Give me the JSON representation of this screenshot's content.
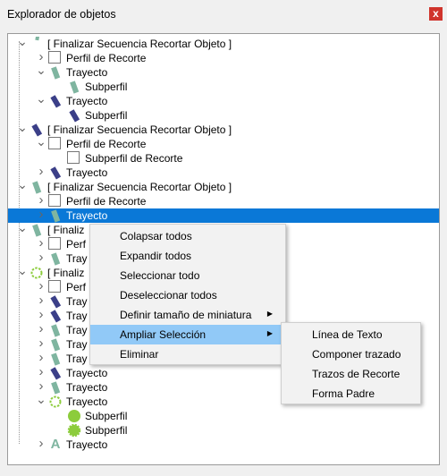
{
  "window": {
    "title": "Explorador de objetos",
    "close_glyph": "x"
  },
  "tree": [
    {
      "level": 0,
      "expand": "v",
      "thumb": "seg-bar",
      "label": "[ Finalizar Secuencia Recortar Objeto ]"
    },
    {
      "level": 1,
      "expand": ">",
      "thumb": "checkbox",
      "label": "Perfil de Recorte"
    },
    {
      "level": 1,
      "expand": "v",
      "thumb": "seg-teal",
      "label": "Trayecto"
    },
    {
      "level": 2,
      "expand": "",
      "thumb": "seg-teal",
      "label": "Subperfil"
    },
    {
      "level": 1,
      "expand": "v",
      "thumb": "seg-navy",
      "label": "Trayecto"
    },
    {
      "level": 2,
      "expand": "",
      "thumb": "seg-navy",
      "label": "Subperfil"
    },
    {
      "level": 0,
      "expand": "v",
      "thumb": "seg-navy",
      "label": "[ Finalizar Secuencia Recortar Objeto ]"
    },
    {
      "level": 1,
      "expand": "v",
      "thumb": "checkbox",
      "label": "Perfil de Recorte"
    },
    {
      "level": 2,
      "expand": "",
      "thumb": "checkbox",
      "label": "Subperfil de Recorte"
    },
    {
      "level": 1,
      "expand": ">",
      "thumb": "seg-navy",
      "label": "Trayecto"
    },
    {
      "level": 0,
      "expand": "v",
      "thumb": "seg-teal",
      "label": "[ Finalizar Secuencia Recortar Objeto ]"
    },
    {
      "level": 1,
      "expand": ">",
      "thumb": "checkbox",
      "label": "Perfil de Recorte"
    },
    {
      "level": 1,
      "expand": ">",
      "thumb": "seg-teal",
      "label": "Trayecto",
      "selected": true
    },
    {
      "level": 0,
      "expand": "v",
      "thumb": "seg-teal",
      "label": "[ Finaliz"
    },
    {
      "level": 1,
      "expand": ">",
      "thumb": "checkbox",
      "label": "Perf"
    },
    {
      "level": 1,
      "expand": ">",
      "thumb": "seg-teal",
      "label": "Tray"
    },
    {
      "level": 0,
      "expand": "v",
      "thumb": "circle-dash",
      "label": "[ Finaliz"
    },
    {
      "level": 1,
      "expand": ">",
      "thumb": "checkbox",
      "label": "Perf"
    },
    {
      "level": 1,
      "expand": ">",
      "thumb": "seg-navy",
      "label": "Tray"
    },
    {
      "level": 1,
      "expand": ">",
      "thumb": "seg-navy",
      "label": "Tray"
    },
    {
      "level": 1,
      "expand": ">",
      "thumb": "seg-teal",
      "label": "Tray"
    },
    {
      "level": 1,
      "expand": ">",
      "thumb": "seg-teal",
      "label": "Tray"
    },
    {
      "level": 1,
      "expand": ">",
      "thumb": "seg-teal",
      "label": "Tray"
    },
    {
      "level": 1,
      "expand": ">",
      "thumb": "seg-navy",
      "label": "Trayecto"
    },
    {
      "level": 1,
      "expand": ">",
      "thumb": "seg-teal",
      "label": "Trayecto"
    },
    {
      "level": 1,
      "expand": "v",
      "thumb": "circle-dash",
      "label": "Trayecto"
    },
    {
      "level": 2,
      "expand": "",
      "thumb": "circle-solid",
      "label": "Subperfil"
    },
    {
      "level": 2,
      "expand": "",
      "thumb": "circle-gear",
      "label": "Subperfil"
    },
    {
      "level": 1,
      "expand": ">",
      "thumb": "letter-a",
      "label": "Trayecto"
    }
  ],
  "context_menu": [
    {
      "label": "Colapsar todos"
    },
    {
      "label": "Expandir todos"
    },
    {
      "label": "Seleccionar todo"
    },
    {
      "label": "Deseleccionar todos"
    },
    {
      "label": "Definir tamaño de miniatura",
      "submenu": true
    },
    {
      "label": "Ampliar Selección",
      "submenu": true,
      "highlighted": true
    },
    {
      "label": "Eliminar"
    }
  ],
  "submenu": [
    {
      "label": "Línea de Texto"
    },
    {
      "label": "Componer trazado"
    },
    {
      "label": "Trazos de Recorte"
    },
    {
      "label": "Forma Padre"
    }
  ],
  "glyphs": {
    "expanded": "v",
    "collapsed": ">",
    "submenu_arrow": "▶",
    "thumb_letter": "A"
  },
  "colors": {
    "teal": "#7fb5a0",
    "navy": "#3b3f88",
    "green": "#8ccc3c",
    "selection": "#0a78d7",
    "menu_highlight": "#91c9f7"
  }
}
